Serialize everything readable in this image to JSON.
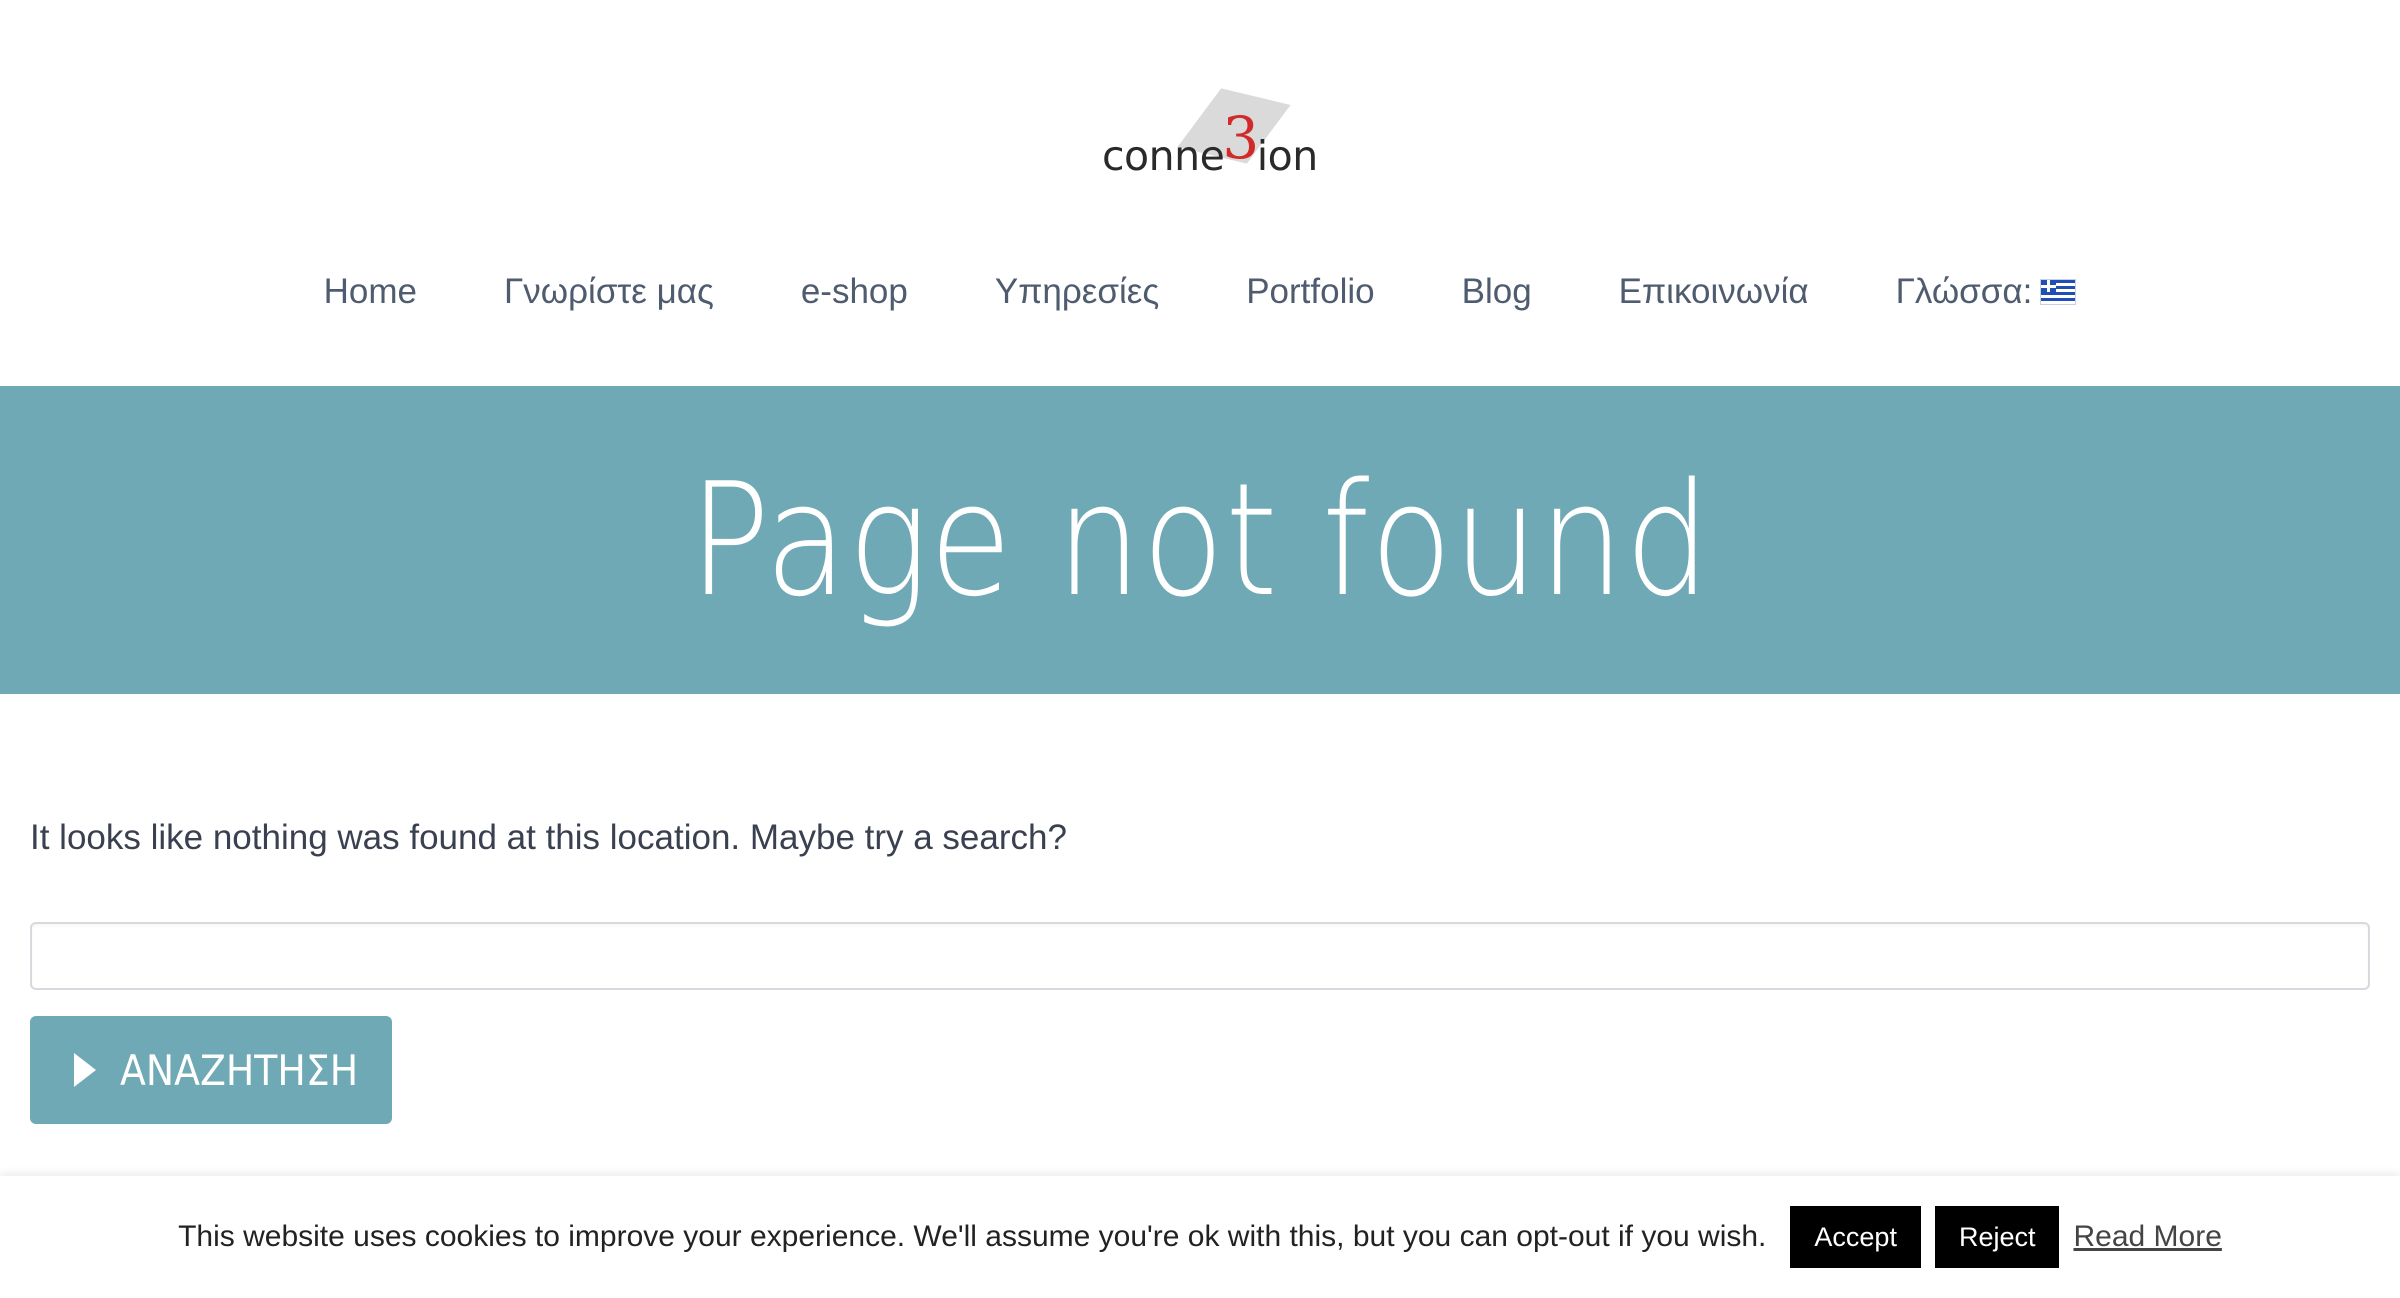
{
  "brand": {
    "logo_text_before": "conne",
    "logo_text_mark": "3",
    "logo_text_after": "ion",
    "accent_color": "#d12a2a"
  },
  "nav": {
    "items": [
      {
        "label": "Home"
      },
      {
        "label": "Γνωρίστε μας"
      },
      {
        "label": "e-shop"
      },
      {
        "label": "Υπηρεσίες"
      },
      {
        "label": "Portfolio"
      },
      {
        "label": "Blog"
      },
      {
        "label": "Επικοινωνία"
      },
      {
        "label": "Γλώσσα:",
        "icon": "greek-flag-icon"
      }
    ]
  },
  "hero": {
    "title": "Page not found",
    "background_color": "#6fa9b5"
  },
  "content": {
    "message": "It looks like nothing was found at this location. Maybe try a search?",
    "search": {
      "value": "",
      "placeholder": ""
    },
    "search_button": {
      "label": "ΑΝΑΖΗΤΗΣΗ",
      "icon": "play-icon"
    }
  },
  "cookie_bar": {
    "text": "This website uses cookies to improve your experience. We'll assume you're ok with this, but you can opt-out if you wish.",
    "accept_label": "Accept",
    "reject_label": "Reject",
    "read_more_label": "Read More"
  }
}
